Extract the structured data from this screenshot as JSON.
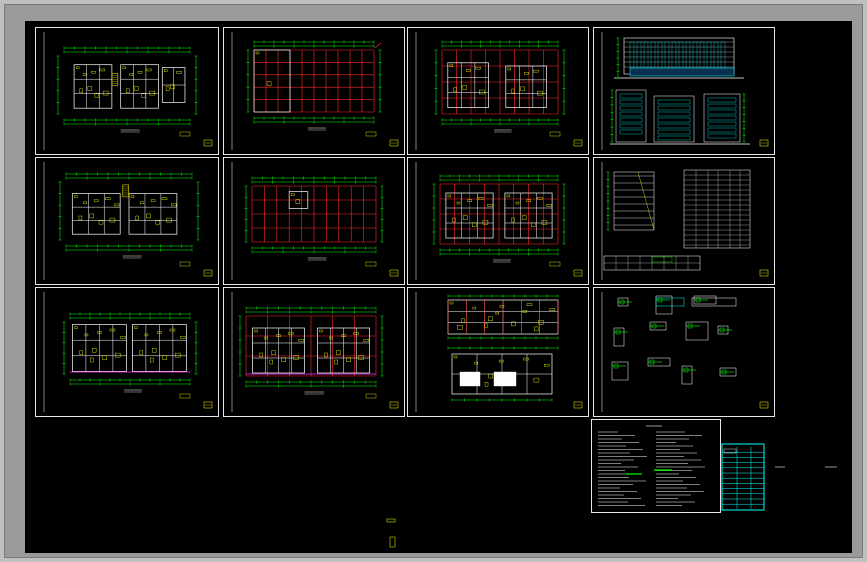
{
  "window": {
    "background": "#bfbfbf"
  },
  "canvas": {
    "background": "#000000",
    "sheet_border": "#e6e6e6"
  },
  "colors": {
    "wall": "#ff2a2a",
    "dimension": "#00ff00",
    "furniture": "#ffff00",
    "line_white": "#ffffff",
    "cyan": "#00ffff",
    "magenta": "#ff33ff"
  },
  "sheets": [
    {
      "id": "r1c1",
      "kind": "plan",
      "caption": ""
    },
    {
      "id": "r1c2",
      "kind": "plan",
      "caption": ""
    },
    {
      "id": "r1c3",
      "kind": "plan",
      "caption": ""
    },
    {
      "id": "r1c4",
      "kind": "elevation",
      "caption": ""
    },
    {
      "id": "r2c1",
      "kind": "plan",
      "caption": ""
    },
    {
      "id": "r2c2",
      "kind": "plan",
      "caption": ""
    },
    {
      "id": "r2c3",
      "kind": "plan",
      "caption": ""
    },
    {
      "id": "r2c4",
      "kind": "section-table",
      "caption": ""
    },
    {
      "id": "r3c1",
      "kind": "plan",
      "caption": ""
    },
    {
      "id": "r3c2",
      "kind": "plan",
      "caption": ""
    },
    {
      "id": "r3c3",
      "kind": "plan",
      "caption": ""
    },
    {
      "id": "r3c4",
      "kind": "details",
      "caption": ""
    },
    {
      "id": "r4c4",
      "kind": "notes",
      "caption": ""
    },
    {
      "id": "r4c5",
      "kind": "title-block",
      "caption": ""
    }
  ]
}
